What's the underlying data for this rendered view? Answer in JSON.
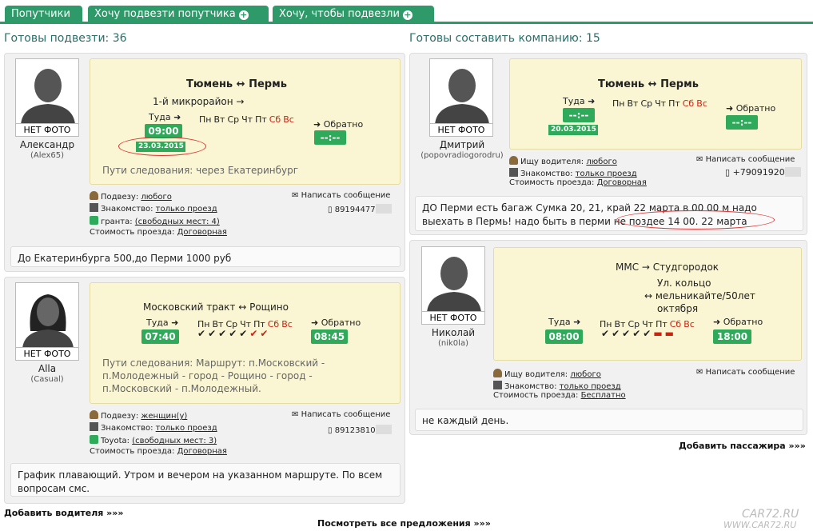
{
  "tabs": [
    {
      "label": "Попутчики"
    },
    {
      "label": "Хочу подвезти попутчика"
    },
    {
      "label": "Хочу, чтобы подвезли"
    }
  ],
  "left_header": "Готовы подвезти: 36",
  "right_header": "Готовы составить компанию: 15",
  "no_photo": "НЕТ ФОТО",
  "labels": {
    "there": "Туда",
    "back": "Обратно",
    "message": "Написать сообщение",
    "cost": "Стоимость проезда:",
    "acquaint": "Знакомство:",
    "picks": "Подвезу:",
    "seek_driver": "Ищу водителя:"
  },
  "weekdays": [
    "Пн",
    "Вт",
    "Ср",
    "Чт",
    "Пт",
    "Сб",
    "Вс"
  ],
  "drivers": [
    {
      "name": "Александр",
      "login": "(Alex65)",
      "route": "Тюмень ↔ Пермь",
      "sub": "1-й микрорайон →",
      "time_there": "09:00",
      "date": "23.03.2015",
      "time_back": "--:--",
      "path": "Пути следования: через Екатеринбург",
      "picks_value": "любого",
      "acquaint_value": "только проезд",
      "car": "гранта:",
      "seats": "(свободных мест: 4)",
      "cost_value": "Договорная",
      "phone": "89194477",
      "note": "До Екатеринбурга 500,до Перми 1000 руб"
    },
    {
      "name": "Alla",
      "login": "(Casual)",
      "route": "Московский тракт ↔ Рощино",
      "time_there": "07:40",
      "time_back": "08:45",
      "path": "Пути следования: Маршрут: п.Московский - п.Молодежный - город - Рощино - город - п.Московский - п.Молодежный.",
      "picks_value": "женщин(у)",
      "acquaint_value": "только проезд",
      "car": "Toyota:",
      "seats": "(свободных мест: 3)",
      "cost_value": "Договорная",
      "phone": "89123810",
      "note": "График плавающий. Утром и вечером на указанном маршруте. По всем вопросам смс."
    }
  ],
  "passengers": [
    {
      "name": "Дмитрий",
      "login": "(popovradiogorodru)",
      "route": "Тюмень ↔ Пермь",
      "time_there": "--:--",
      "date": "20.03.2015",
      "time_back": "--:--",
      "seek_value": "любого",
      "acquaint_value": "только проезд",
      "cost_value": "Договорная",
      "phone": "+79091920",
      "note": "ДО Перми есть багаж Сумка 20, 21, край 22 марта в 00 00 м надо выехать в Пермь! надо быть в перми не поздее 14 00. 22 марта"
    },
    {
      "name": "Николай",
      "login": "(nik0la)",
      "route": "ММС → Студгородок",
      "sub1": "Ул. кольцо",
      "sub2": "мельникайте/50лет",
      "sub3": "октября",
      "time_there": "08:00",
      "time_back": "18:00",
      "seek_value": "любого",
      "acquaint_value": "только проезд",
      "cost_value": "Бесплатно",
      "note": "не каждый день."
    }
  ],
  "add_passenger": "Добавить пассажира »»»",
  "add_driver": "Добавить водителя »»»",
  "view_all": "Посмотреть все предложения »»»",
  "watermark1": "CAR72.RU",
  "watermark2": "WWW.CAR72.RU",
  "colors": {
    "green": "#2e9a6a",
    "route_bg": "#faf6d3",
    "weekend": "#c21"
  }
}
